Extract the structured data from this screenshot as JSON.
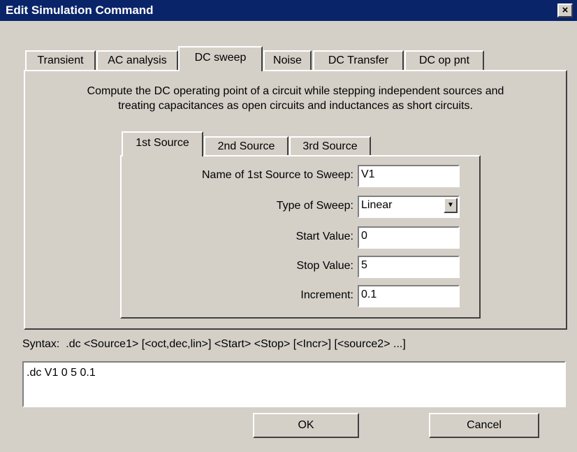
{
  "window": {
    "title": "Edit Simulation Command",
    "close_glyph": "×"
  },
  "tabs": [
    "Transient",
    "AC analysis",
    "DC sweep",
    "Noise",
    "DC Transfer",
    "DC op pnt"
  ],
  "active_tab": "DC sweep",
  "description": {
    "line1": "Compute the DC operating point of a circuit while stepping independent sources and",
    "line2": "treating capacitances as open circuits and inductances as short circuits."
  },
  "source_tabs": [
    "1st Source",
    "2nd Source",
    "3rd Source"
  ],
  "active_source_tab": "1st Source",
  "form": {
    "name_label": "Name of 1st Source to Sweep:",
    "name_value": "V1",
    "type_label": "Type of Sweep:",
    "type_value": "Linear",
    "start_label": "Start Value:",
    "start_value": "0",
    "stop_label": "Stop Value:",
    "stop_value": "5",
    "incr_label": "Increment:",
    "incr_value": "0.1"
  },
  "syntax": "Syntax:  .dc <Source1> [<oct,dec,lin>] <Start> <Stop> [<Incr>] [<source2> ...]",
  "command_text": ".dc V1 0 5 0.1",
  "buttons": {
    "ok": "OK",
    "cancel": "Cancel"
  }
}
